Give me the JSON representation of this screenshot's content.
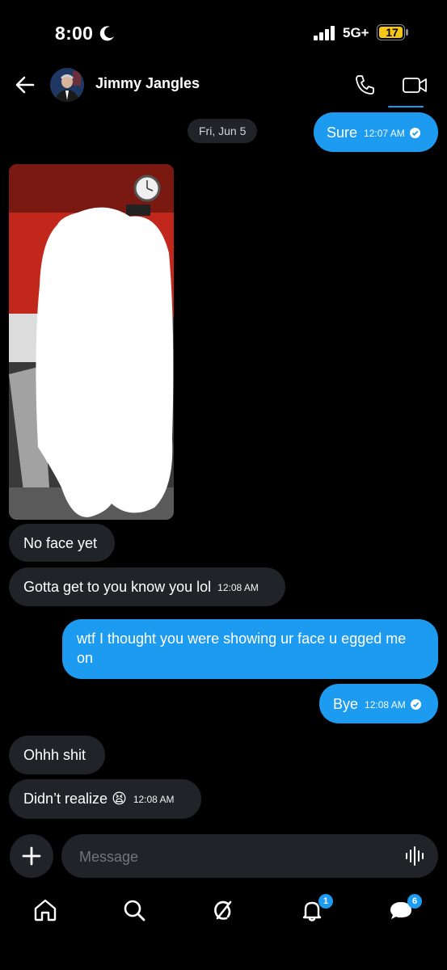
{
  "status_bar": {
    "time": "8:00",
    "network": "5G+",
    "battery": "17"
  },
  "header": {
    "contact_name": "Jimmy Jangles"
  },
  "date_divider": "Fri, Jun 5",
  "messages": [
    {
      "direction": "out",
      "text": "Sure",
      "time": "12:07 AM",
      "read": true
    },
    {
      "direction": "in",
      "type": "image",
      "content": "redacted photo"
    },
    {
      "direction": "in",
      "text": "No face yet"
    },
    {
      "direction": "in",
      "text": "Gotta get to you know you lol",
      "time": "12:08 AM"
    },
    {
      "direction": "out",
      "text": "wtf I thought you were showing ur face u egged me on"
    },
    {
      "direction": "out",
      "text": "Bye",
      "time": "12:08 AM",
      "read": true
    },
    {
      "direction": "in",
      "text": "Ohhh shit"
    },
    {
      "direction": "in",
      "text": "Didn’t realize",
      "emoji": "😫",
      "time": "12:08 AM"
    }
  ],
  "composer": {
    "placeholder": "Message"
  },
  "bottom_nav": {
    "items": [
      "home",
      "search",
      "grok",
      "notifications",
      "messages"
    ],
    "notifications_badge": "1",
    "messages_badge": "6"
  },
  "colors": {
    "accent": "#1d9bf0",
    "background": "#000000",
    "incoming_bubble": "#202327"
  }
}
